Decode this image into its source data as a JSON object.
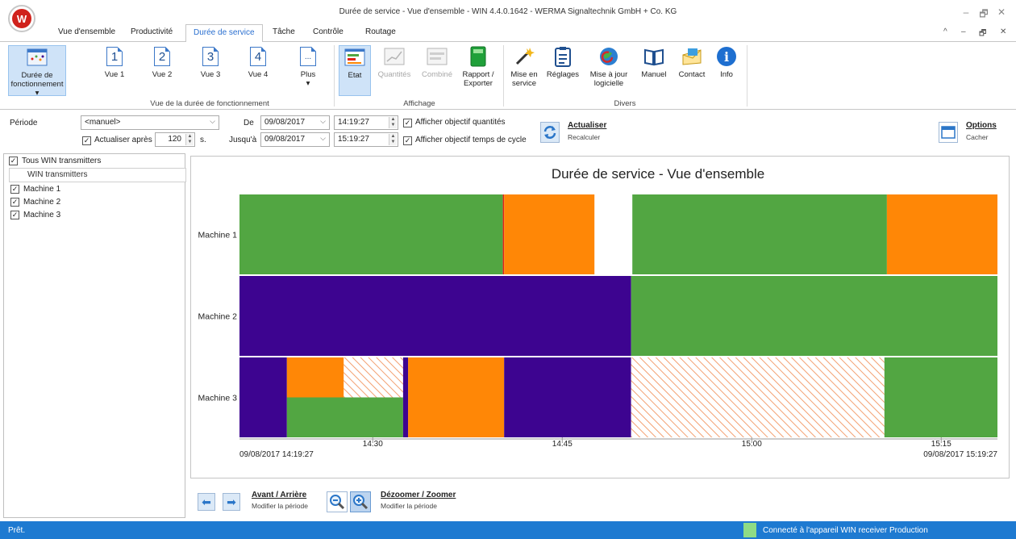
{
  "window": {
    "title": "Durée de service - Vue d'ensemble - WIN 4.4.0.1642 - WERMA Signaltechnik GmbH + Co. KG",
    "logo_text": "W",
    "ctl_minimize": "–",
    "ctl_restore": "🗗",
    "ctl_close": "✕"
  },
  "tabs": [
    {
      "label": "Vue d'ensemble"
    },
    {
      "label": "Productivité"
    },
    {
      "label": "Durée de service",
      "active": true
    },
    {
      "label": "Tâche"
    },
    {
      "label": "Contrôle"
    },
    {
      "label": "Routage"
    }
  ],
  "tab_controls": {
    "collapse": "^",
    "min": "–",
    "restore": "🗗",
    "close": "✕"
  },
  "ribbon": {
    "buttons": {
      "duree": {
        "label": "Durée de fonctionnement",
        "dropdown": "▾"
      },
      "vue1": {
        "label": "Vue 1",
        "num": "1"
      },
      "vue2": {
        "label": "Vue 2",
        "num": "2"
      },
      "vue3": {
        "label": "Vue 3",
        "num": "3"
      },
      "vue4": {
        "label": "Vue 4",
        "num": "4"
      },
      "plus": {
        "label": "Plus",
        "icon_text": "...",
        "dropdown": "▾"
      },
      "etat": {
        "label": "Etat"
      },
      "quantites": {
        "label": "Quantités"
      },
      "combine": {
        "label": "Combiné"
      },
      "rapport": {
        "label": "Rapport / Exporter"
      },
      "mise_service": {
        "label": "Mise en service"
      },
      "reglages": {
        "label": "Réglages"
      },
      "mise_jour": {
        "label": "Mise à jour logicielle"
      },
      "manuel": {
        "label": "Manuel"
      },
      "contact": {
        "label": "Contact"
      },
      "info": {
        "label": "Info",
        "icon_text": "i"
      }
    },
    "groups": {
      "vue": "Vue de la durée de fonctionnement",
      "affichage": "Affichage",
      "divers": "Divers"
    }
  },
  "period": {
    "label": "Période",
    "preset": "<manuel>",
    "from_label": "De",
    "from_date": "09/08/2017",
    "from_time": "14:19:27",
    "to_label": "Jusqu'à",
    "to_date": "09/08/2017",
    "to_time": "15:19:27",
    "refresh_after_label": "Actualiser après",
    "refresh_after_checked": true,
    "refresh_after_value": "120",
    "refresh_after_unit": "s.",
    "show_qty_target": "Afficher objectif quantités",
    "show_cycle_target": "Afficher objectif temps de cycle",
    "actualiser_title": "Actualiser",
    "actualiser_sub": "Recalculer",
    "options_title": "Options",
    "options_sub": "Cacher",
    "check_mark": "✓",
    "dd_arrow": "⌵",
    "spin_up": "▲",
    "spin_down": "▼"
  },
  "left_panel": {
    "all_label": "Tous WIN transmitters",
    "all_checked": true,
    "header": "WIN transmitters",
    "machines": [
      {
        "name": "Machine 1",
        "checked": true
      },
      {
        "name": "Machine 2",
        "checked": true
      },
      {
        "name": "Machine 3",
        "checked": true
      }
    ]
  },
  "colors": {
    "green": "#52a642",
    "orange": "#ff8706",
    "purple": "#3d0490",
    "red": "#e0241a",
    "hatch": "#f3a071",
    "accent": "#2a6fd0",
    "status_bar": "#1e7ad1"
  },
  "chart_data": {
    "type": "timeline",
    "title": "Durée de service - Vue d'ensemble",
    "x_range": [
      "14:19:27",
      "15:19:27"
    ],
    "start_label": "09/08/2017 14:19:27",
    "end_label": "09/08/2017 15:19:27",
    "ticks": [
      "14:30",
      "14:45",
      "15:00",
      "15:15"
    ],
    "rows": [
      {
        "name": "Machine 1",
        "segments": [
          {
            "start": "14:19:27",
            "end": "14:40:18",
            "state": "green"
          },
          {
            "start": "14:40:18",
            "end": "14:40:24",
            "state": "red"
          },
          {
            "start": "14:40:24",
            "end": "14:47:33",
            "state": "orange"
          },
          {
            "start": "14:47:33",
            "end": "14:50:33",
            "state": "none"
          },
          {
            "start": "14:50:33",
            "end": "15:10:42",
            "state": "green"
          },
          {
            "start": "15:10:42",
            "end": "15:19:27",
            "state": "orange"
          }
        ]
      },
      {
        "name": "Machine 2",
        "segments": [
          {
            "start": "14:19:27",
            "end": "14:50:27",
            "state": "purple"
          },
          {
            "start": "14:50:27",
            "end": "15:19:27",
            "state": "green"
          }
        ]
      },
      {
        "name": "Machine 3",
        "segments": [
          {
            "start": "14:19:27",
            "end": "14:23:12",
            "state": "purple"
          },
          {
            "start": "14:23:12",
            "end": "14:27:42",
            "state": "orange",
            "part": "upper"
          },
          {
            "start": "14:27:42",
            "end": "14:32:24",
            "state": "hatch",
            "part": "upper"
          },
          {
            "start": "14:23:12",
            "end": "14:32:24",
            "state": "green",
            "part": "lower"
          },
          {
            "start": "14:32:24",
            "end": "14:32:48",
            "state": "purple"
          },
          {
            "start": "14:32:48",
            "end": "14:40:24",
            "state": "orange"
          },
          {
            "start": "14:40:24",
            "end": "14:50:27",
            "state": "purple"
          },
          {
            "start": "14:50:27",
            "end": "15:10:30",
            "state": "hatch"
          },
          {
            "start": "15:10:30",
            "end": "15:19:27",
            "state": "green"
          }
        ]
      }
    ]
  },
  "nav": {
    "avant_title": "Avant / Arrière",
    "avant_sub": "Modifier la période",
    "zoom_title": "Dézoomer / Zoomer",
    "zoom_sub": "Modifier la période",
    "back_arrow": "⬅",
    "fwd_arrow": "➡"
  },
  "status": {
    "left": "Prêt.",
    "right": "Connecté à l'appareil WIN receiver Production"
  }
}
